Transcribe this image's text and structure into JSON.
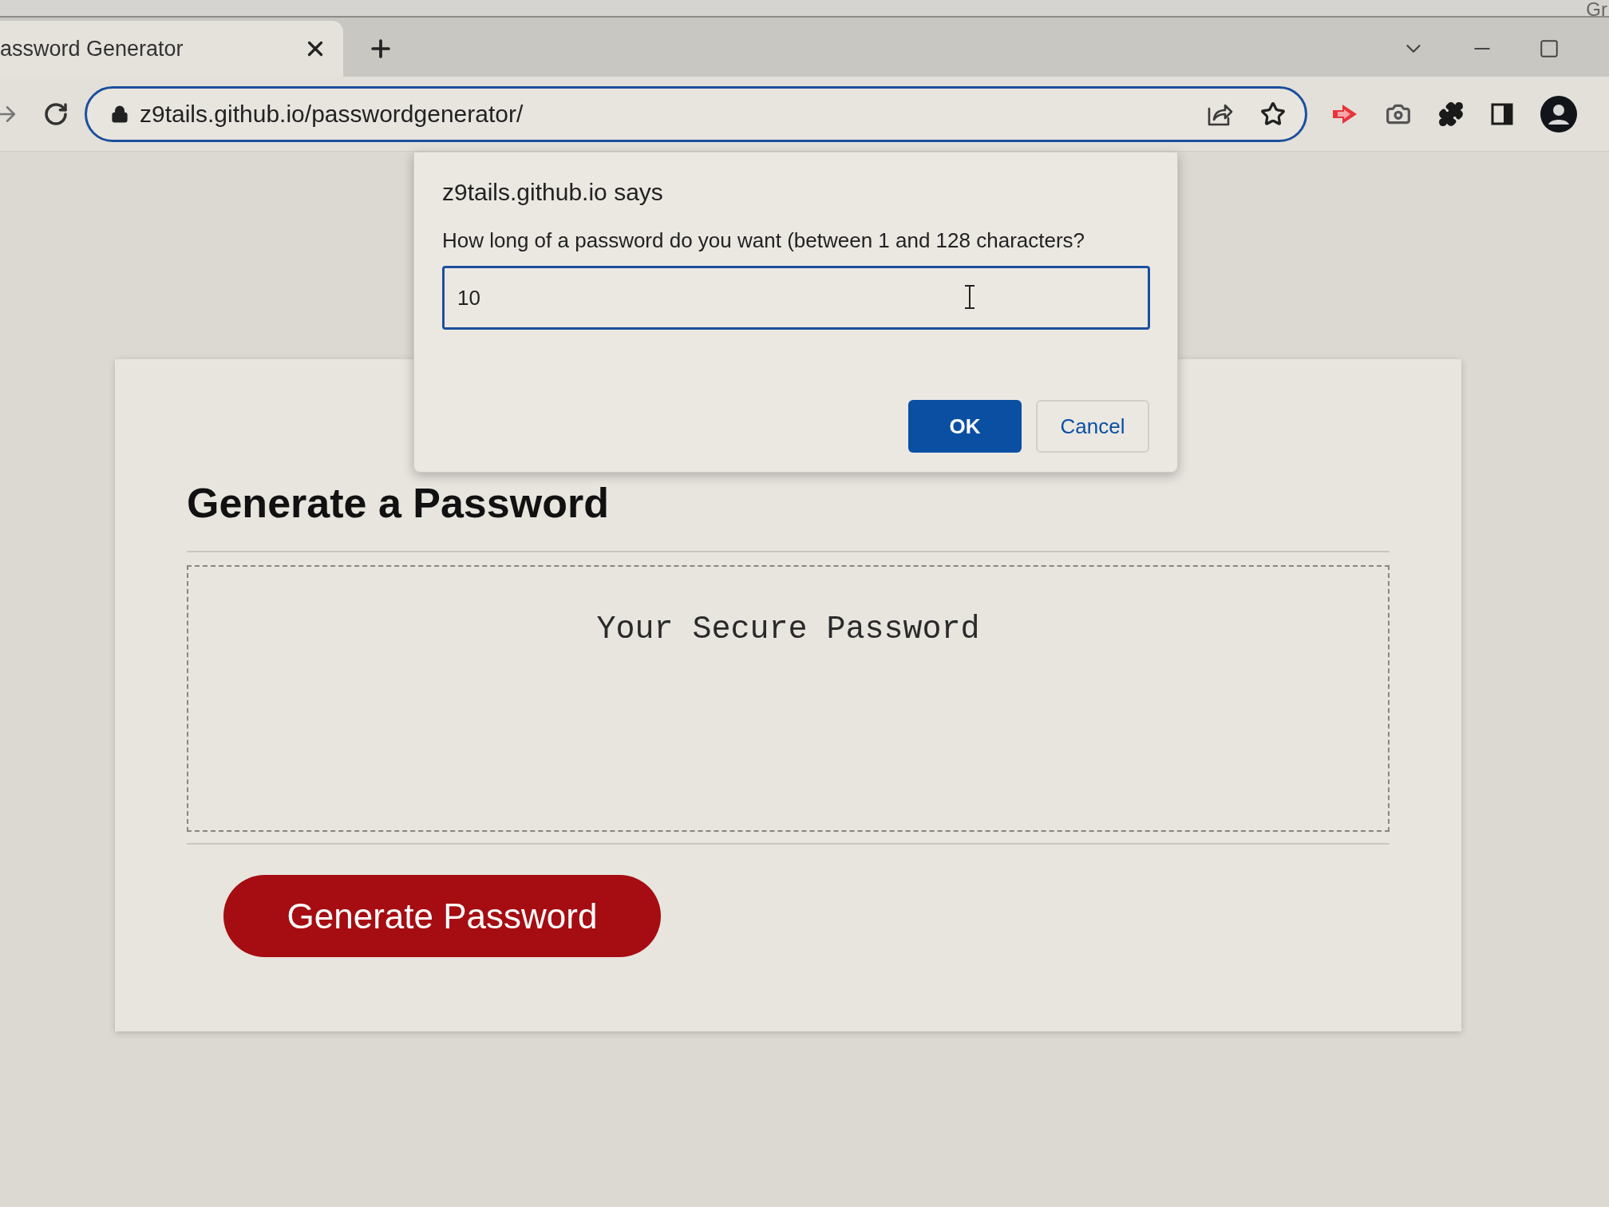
{
  "browser": {
    "corner_text": "Gr",
    "tab": {
      "title": "assword Generator",
      "selected": true
    },
    "address_bar": {
      "url": "z9tails.github.io/passwordgenerator/"
    }
  },
  "page": {
    "heading": "Generate a Password",
    "password_box": {
      "placeholder": "Your Secure Password"
    },
    "generate_button": "Generate Password"
  },
  "dialog": {
    "title": "z9tails.github.io says",
    "message": "How long of a password do you want (between 1 and 128 characters?",
    "input": {
      "value": "10"
    },
    "buttons": [
      {
        "label": "OK",
        "kind": "primary"
      },
      {
        "label": "Cancel",
        "kind": "secondary"
      }
    ]
  }
}
